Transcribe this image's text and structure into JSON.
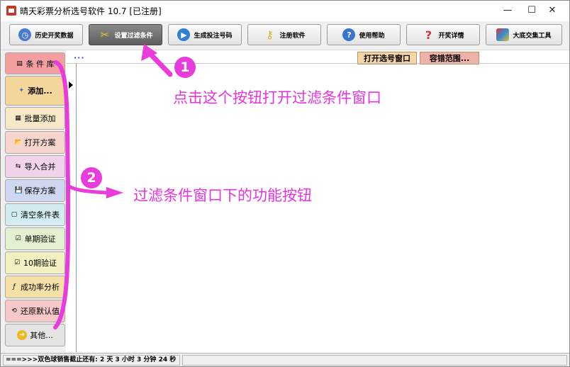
{
  "window": {
    "title": "晴天彩票分析选号软件 10.7  [已注册]",
    "controls": {
      "minimize": "—",
      "maximize": "☐",
      "close": "✕"
    }
  },
  "toolbar": {
    "buttons": [
      {
        "label": "历史开奖数据",
        "icon": "history-icon",
        "color": "#4a7bd0"
      },
      {
        "label": "设置过滤条件",
        "icon": "tools-icon",
        "color": "#c05030",
        "active": true
      },
      {
        "label": "生成投注号码",
        "icon": "play-icon",
        "color": "#2e7fd6"
      },
      {
        "label": "注册软件",
        "icon": "key-icon",
        "color": "#d6b020"
      },
      {
        "label": "使用帮助",
        "icon": "help-icon",
        "color": "#3a72d0"
      },
      {
        "label": "开奖详情",
        "icon": "question-icon",
        "color": "#d63040"
      },
      {
        "label": "大底交集工具",
        "icon": "cubes-icon",
        "color": "#7a3ad0"
      }
    ]
  },
  "sidebar": {
    "buttons": [
      {
        "label": "条 件 库",
        "icon": "▤",
        "bg": "#f4a0a0"
      },
      {
        "label": "添加...",
        "icon": "✦",
        "bg": "#f5d69a"
      },
      {
        "label": "批量添加",
        "icon": "▦",
        "bg": "#f6e7c8"
      },
      {
        "label": "打开方案",
        "icon": "📂",
        "bg": "#f6d6cc"
      },
      {
        "label": "导入合并",
        "icon": "⇆",
        "bg": "#f0d2ea"
      },
      {
        "label": "保存方案",
        "icon": "💾",
        "bg": "#cfd8f0"
      },
      {
        "label": "清空条件表",
        "icon": "▢",
        "bg": "#d2ecf2"
      },
      {
        "label": "单期验证",
        "icon": "☑",
        "bg": "#e2f0d0"
      },
      {
        "label": "10期验证",
        "icon": "☑",
        "bg": "#f2f0c0"
      },
      {
        "label": "成功率分析",
        "icon": "ƒ",
        "bg": "#f5e0a8"
      },
      {
        "label": "还原默认值",
        "icon": "⟲",
        "bg": "#f6c8c8"
      },
      {
        "label": "其他...",
        "icon": "➜",
        "bg": "#e4e4e4"
      }
    ]
  },
  "grid": {
    "dots": "···",
    "tags": [
      {
        "label": "打开选号窗口",
        "bg": "#f4d5a6"
      },
      {
        "label": "容错范围...",
        "bg": "#f0b2a8"
      }
    ]
  },
  "statusbar": {
    "text": "===>>>双色球销售截止还有: 2 天 3 小时 3 分钟 24 秒"
  },
  "annotations": {
    "step1": {
      "number": "1",
      "text": "点击这个按钮打开过滤条件窗口"
    },
    "step2": {
      "number": "2",
      "text": "过滤条件窗口下的功能按钮"
    },
    "color": "#e633e0"
  }
}
